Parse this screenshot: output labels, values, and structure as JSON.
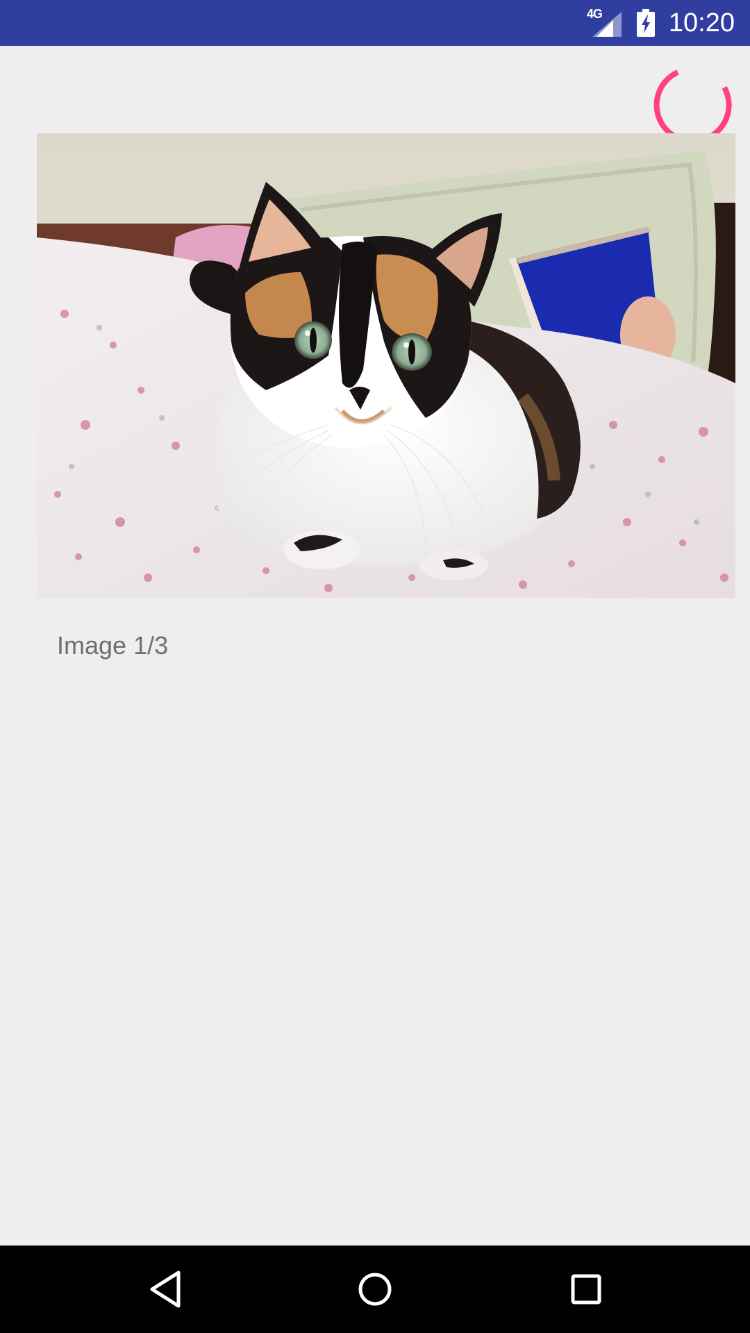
{
  "status_bar": {
    "network": "4G",
    "time": "10:20",
    "color": "#303f9f",
    "icons": [
      "signal-icon",
      "battery-charging-icon"
    ]
  },
  "spinner": {
    "color": "#ff4081",
    "icon": "loading-spinner-icon"
  },
  "gallery": {
    "image_subject": "calico cat lying on floral bedspread",
    "caption": "Image 1/3",
    "current": 1,
    "total": 3
  },
  "nav_bar": {
    "buttons": [
      "back-icon",
      "home-icon",
      "recents-icon"
    ]
  },
  "colors": {
    "background": "#eeeeee",
    "caption_text": "#6e6e6e"
  }
}
